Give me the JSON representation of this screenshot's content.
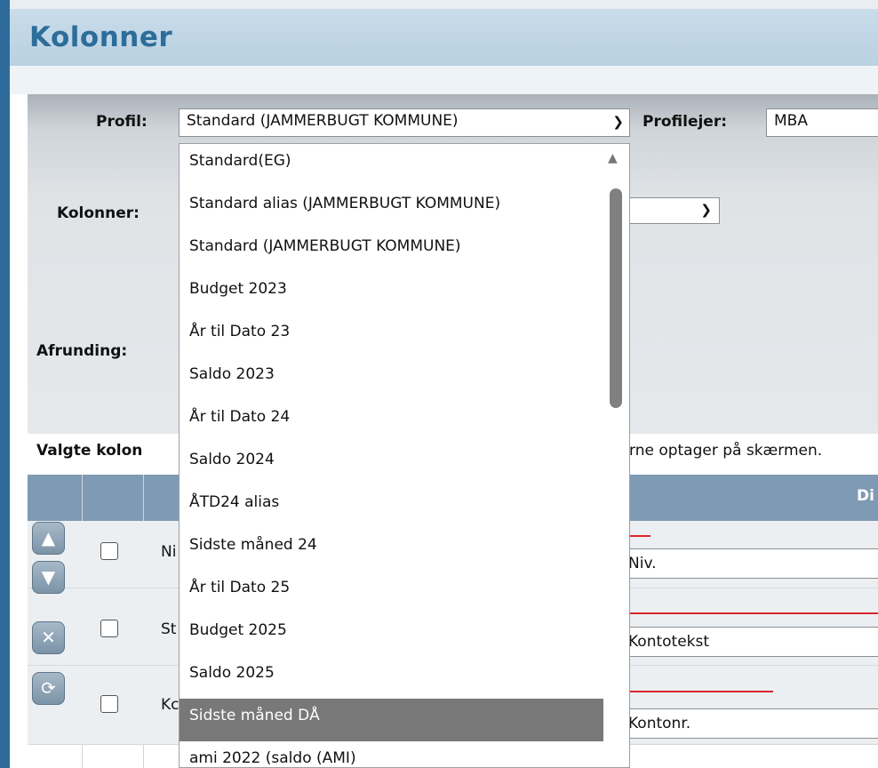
{
  "page": {
    "title": "Kolonner"
  },
  "filters": {
    "profil_label": "Profil:",
    "profil_value": "Standard (JAMMERBUGT KOMMUNE)",
    "profilejer_label": "Profilejer:",
    "profilejer_value": "MBA",
    "kolonner_label": "Kolonner:",
    "afrunding_label": "Afrunding:"
  },
  "columns_section": {
    "heading_prefix": "Valgte kolon",
    "heading_suffix": "rne optager på skærmen.",
    "header_right": "Di"
  },
  "rows": [
    {
      "cut_text": "Ni",
      "input_value": "Niv."
    },
    {
      "cut_text": "St",
      "input_value": "Kontotekst"
    },
    {
      "cut_text": "Kc",
      "input_value": "Kontonr."
    }
  ],
  "dropdown": {
    "options": [
      "Standard(EG)",
      "Standard alias (JAMMERBUGT KOMMUNE)",
      "Standard (JAMMERBUGT KOMMUNE)",
      "Budget 2023",
      "År til Dato 23",
      "Saldo 2023",
      "År til Dato 24",
      "Saldo 2024",
      "ÅTD24 alias",
      "Sidste måned 24",
      "År til Dato 25",
      "Budget 2025",
      "Saldo 2025",
      "Sidste måned DÅ",
      "ami 2022 (saldo (AMI)"
    ],
    "selected_index": 13
  },
  "icons": {
    "move_up": "arrow-up-icon",
    "move_down": "arrow-down-icon",
    "remove": "close-icon",
    "reset": "refresh-icon"
  },
  "colors": {
    "title": "#2c6d99",
    "header_bar": "#7f9ab4",
    "selected_option": "#787878",
    "required_line": "#d9272e"
  }
}
